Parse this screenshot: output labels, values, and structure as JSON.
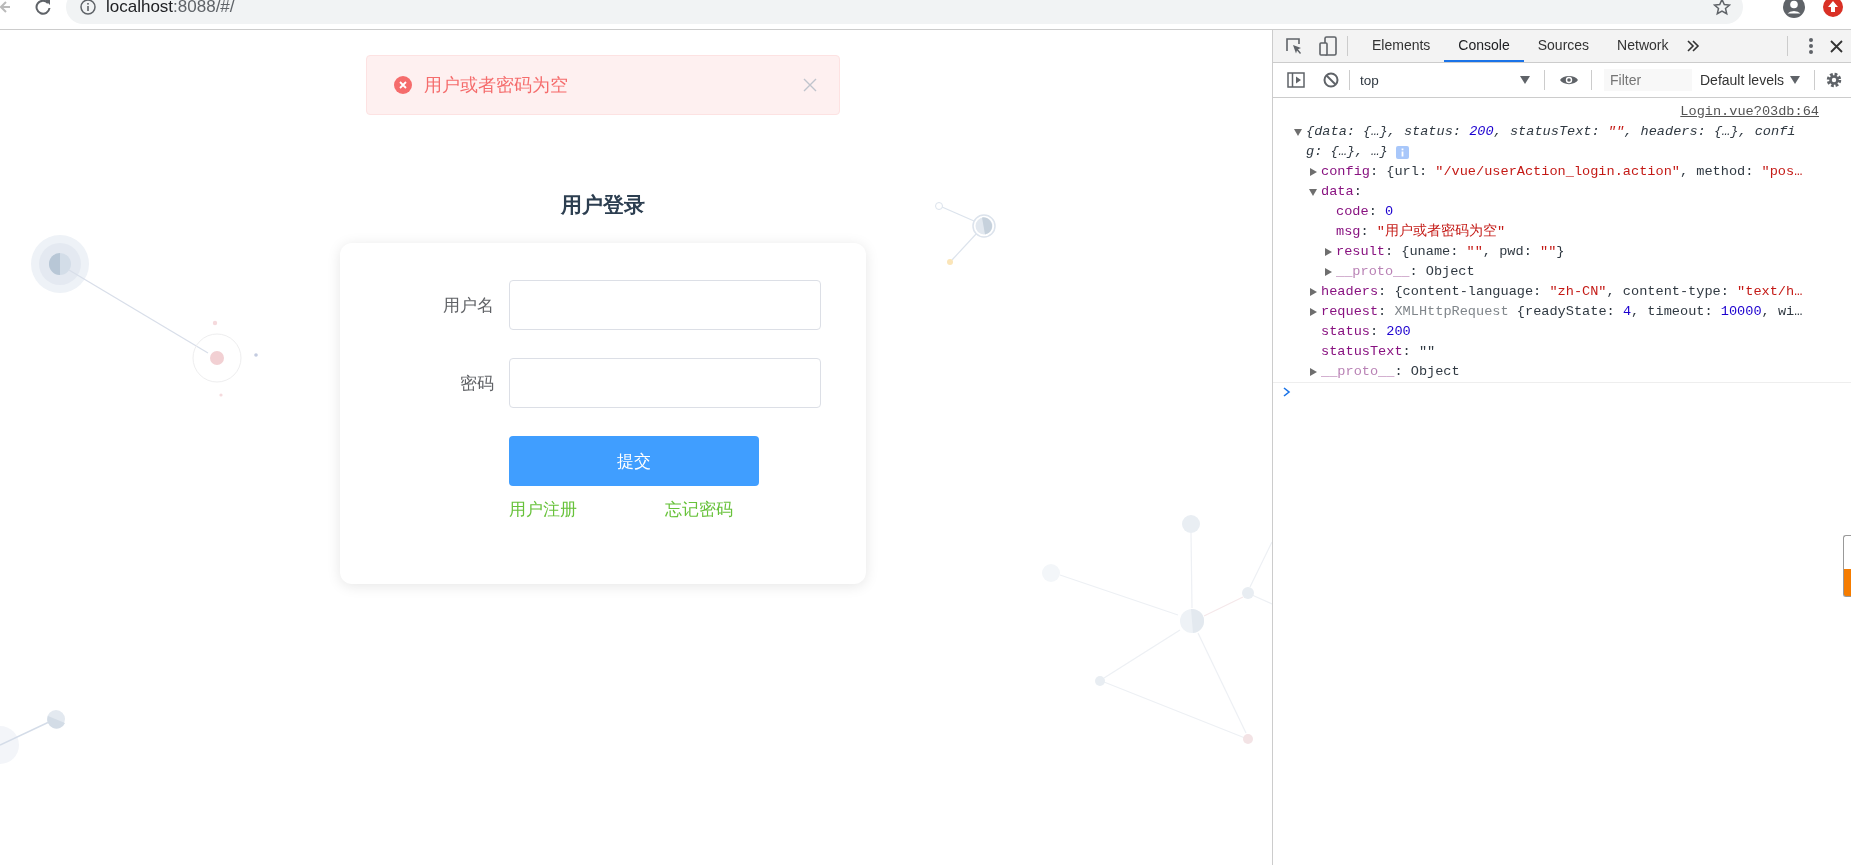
{
  "browser": {
    "url_host": "localhost",
    "url_path": ":8088/#/"
  },
  "page": {
    "alert": {
      "kind": "error",
      "message": "用户或者密码为空"
    },
    "title": "用户登录",
    "fields": [
      {
        "label": "用户名"
      },
      {
        "label": "密码"
      }
    ],
    "submit": "提交",
    "links": [
      {
        "text": "用户注册"
      },
      {
        "text": "忘记密码"
      }
    ]
  },
  "devtools": {
    "tabs": [
      {
        "label": "Elements",
        "selected": false
      },
      {
        "label": "Console",
        "selected": true
      },
      {
        "label": "Sources",
        "selected": false
      },
      {
        "label": "Network",
        "selected": false
      }
    ],
    "context": "top",
    "filter": {
      "placeholder": "Filter"
    },
    "levels": "Default levels",
    "console": {
      "source": "Login.vue?03db:64",
      "entries": [
        {
          "kind": "summary",
          "expanded": true,
          "lines": [
            [
              {
                "text": "{data: {…}, status: ",
                "kind": "plain"
              },
              {
                "text": "200",
                "kind": "number"
              },
              {
                "text": ", statusText: ",
                "kind": "plain"
              },
              {
                "text": "\"\"",
                "kind": "string"
              },
              {
                "text": ", headers: {…}, confi",
                "kind": "plain"
              }
            ],
            [
              {
                "text": "g: {…}, …}",
                "kind": "plain"
              }
            ]
          ],
          "children": [
            {
              "expanded": false,
              "tokens": [
                {
                  "text": "config",
                  "kind": "key"
                },
                {
                  "text": ": {url: ",
                  "kind": "plain"
                },
                {
                  "text": "\"/vue/userAction_login.action\"",
                  "kind": "string"
                },
                {
                  "text": ", method: ",
                  "kind": "plain"
                },
                {
                  "text": "\"pos…",
                  "kind": "string"
                }
              ]
            },
            {
              "expanded": true,
              "tokens": [
                {
                  "text": "data",
                  "kind": "key"
                },
                {
                  "text": ":",
                  "kind": "plain"
                }
              ],
              "children": [
                {
                  "tokens": [
                    {
                      "text": "code",
                      "kind": "key"
                    },
                    {
                      "text": ": ",
                      "kind": "plain"
                    },
                    {
                      "text": "0",
                      "kind": "number"
                    }
                  ]
                },
                {
                  "tokens": [
                    {
                      "text": "msg",
                      "kind": "key"
                    },
                    {
                      "text": ": ",
                      "kind": "plain"
                    },
                    {
                      "text": "\"用户或者密码为空\"",
                      "kind": "string"
                    }
                  ]
                },
                {
                  "expanded": false,
                  "tokens": [
                    {
                      "text": "result",
                      "kind": "key"
                    },
                    {
                      "text": ": {uname: ",
                      "kind": "plain"
                    },
                    {
                      "text": "\"\"",
                      "kind": "string"
                    },
                    {
                      "text": ", pwd: ",
                      "kind": "plain"
                    },
                    {
                      "text": "\"\"",
                      "kind": "string"
                    },
                    {
                      "text": "}",
                      "kind": "plain"
                    }
                  ]
                },
                {
                  "expanded": false,
                  "tokens": [
                    {
                      "text": "__proto__",
                      "kind": "key_dim"
                    },
                    {
                      "text": ": Object",
                      "kind": "plain"
                    }
                  ]
                }
              ]
            },
            {
              "expanded": false,
              "tokens": [
                {
                  "text": "headers",
                  "kind": "key"
                },
                {
                  "text": ": {content-language: ",
                  "kind": "plain"
                },
                {
                  "text": "\"zh-CN\"",
                  "kind": "string"
                },
                {
                  "text": ", content-type: ",
                  "kind": "plain"
                },
                {
                  "text": "\"text/h…",
                  "kind": "string"
                }
              ]
            },
            {
              "expanded": false,
              "tokens": [
                {
                  "text": "request",
                  "kind": "key"
                },
                {
                  "text": ": ",
                  "kind": "plain"
                },
                {
                  "text": "XMLHttpRequest",
                  "kind": "muted"
                },
                {
                  "text": " {readyState: ",
                  "kind": "plain"
                },
                {
                  "text": "4",
                  "kind": "number"
                },
                {
                  "text": ", timeout: ",
                  "kind": "plain"
                },
                {
                  "text": "10000",
                  "kind": "number"
                },
                {
                  "text": ", wi…",
                  "kind": "plain"
                }
              ]
            },
            {
              "tokens": [
                {
                  "text": "status",
                  "kind": "key"
                },
                {
                  "text": ": ",
                  "kind": "plain"
                },
                {
                  "text": "200",
                  "kind": "number"
                }
              ]
            },
            {
              "tokens": [
                {
                  "text": "statusText",
                  "kind": "key"
                },
                {
                  "text": ": ",
                  "kind": "plain"
                },
                {
                  "text": "\"\"",
                  "kind": "plain"
                }
              ]
            },
            {
              "expanded": false,
              "tokens": [
                {
                  "text": "__proto__",
                  "kind": "key_dim"
                },
                {
                  "text": ": Object",
                  "kind": "plain"
                }
              ]
            }
          ]
        }
      ]
    }
  }
}
